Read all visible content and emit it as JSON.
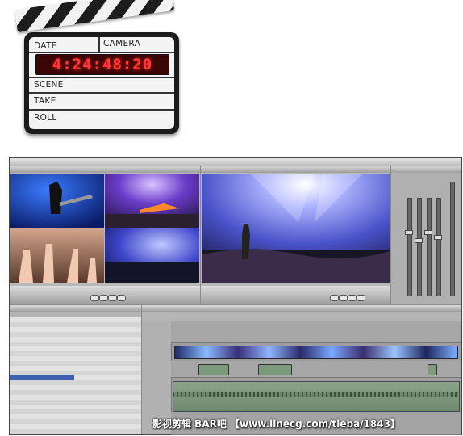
{
  "clapperboard": {
    "date_label": "DATE",
    "camera_label": "CAMERA",
    "timecode": "4:24:48:20",
    "scene_label": "SCENE",
    "take_label": "TAKE",
    "roll_label": "ROLL",
    "stick_color": "#1d1d1d",
    "timecode_color": "#ff3a3a"
  },
  "watermark": "影视剪辑 BAR吧 【www.linecg.com/tieba/1843】"
}
